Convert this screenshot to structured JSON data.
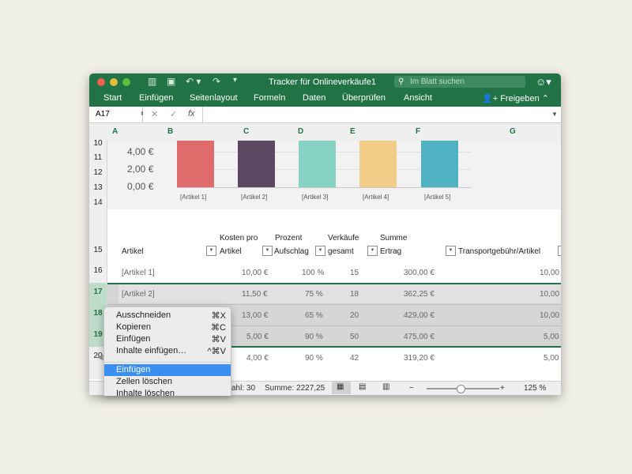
{
  "window": {
    "title": "Tracker für Onlineverkäufe1",
    "search_placeholder": "Im Blatt suchen"
  },
  "ribbon": {
    "tabs": [
      "Start",
      "Einfügen",
      "Seitenlayout",
      "Formeln",
      "Daten",
      "Überprüfen",
      "Ansicht"
    ],
    "share_label": "Freigeben"
  },
  "formula_bar": {
    "name_box": "A17",
    "fx": "fx"
  },
  "columns": [
    "A",
    "B",
    "C",
    "D",
    "E",
    "F",
    "G"
  ],
  "rows": [
    "10",
    "11",
    "12",
    "13",
    "14",
    "15",
    "16",
    "17",
    "18",
    "19",
    "20"
  ],
  "chart_data": {
    "type": "bar",
    "categories": [
      "[Artikel 1]",
      "[Artikel 2]",
      "[Artikel 3]",
      "[Artikel 4]",
      "[Artikel 5]"
    ],
    "colors": [
      "#e06b6b",
      "#5d4863",
      "#87d2c4",
      "#f2cd88",
      "#4fb2c3"
    ],
    "y_ticks": [
      "4,00 €",
      "2,00 €",
      "0,00 €"
    ],
    "ylim": [
      0,
      8
    ],
    "note": "bars extend above visible area"
  },
  "table": {
    "headers": [
      {
        "line1": "",
        "line2": "Artikel"
      },
      {
        "line1": "Kosten pro",
        "line2": "Artikel"
      },
      {
        "line1": "Prozent",
        "line2": "Aufschlag"
      },
      {
        "line1": "Verkäufe",
        "line2": "gesamt"
      },
      {
        "line1": "Summe",
        "line2": "Ertrag"
      },
      {
        "line1": "",
        "line2": "Transportgebühr/Artikel"
      }
    ],
    "rows": [
      [
        "[Artikel 1]",
        "10,00 €",
        "100 %",
        "15",
        "300,00 €",
        "10,00"
      ],
      [
        "[Artikel 2]",
        "11,50 €",
        "75 %",
        "18",
        "362,25 €",
        "10,00"
      ],
      [
        "",
        "13,00 €",
        "65 %",
        "20",
        "429,00 €",
        "10,00"
      ],
      [
        "",
        "5,00 €",
        "90 %",
        "50",
        "475,00 €",
        "5,00"
      ],
      [
        "",
        "4,00 €",
        "90 %",
        "42",
        "319,20 €",
        "5,00"
      ]
    ]
  },
  "status_bar": {
    "count": "ahl: 30",
    "sum": "Summe: 2227,25",
    "zoom": "125 %"
  },
  "context_menu": {
    "items": [
      {
        "label": "Ausschneiden",
        "shortcut": "⌘X"
      },
      {
        "label": "Kopieren",
        "shortcut": "⌘C"
      },
      {
        "label": "Einfügen",
        "shortcut": "⌘V"
      },
      {
        "label": "Inhalte einfügen…",
        "shortcut": "^⌘V"
      },
      {
        "label": "Einfügen",
        "shortcut": ""
      },
      {
        "label": "Zellen löschen",
        "shortcut": ""
      },
      {
        "label": "Inhalte löschen",
        "shortcut": ""
      }
    ]
  }
}
